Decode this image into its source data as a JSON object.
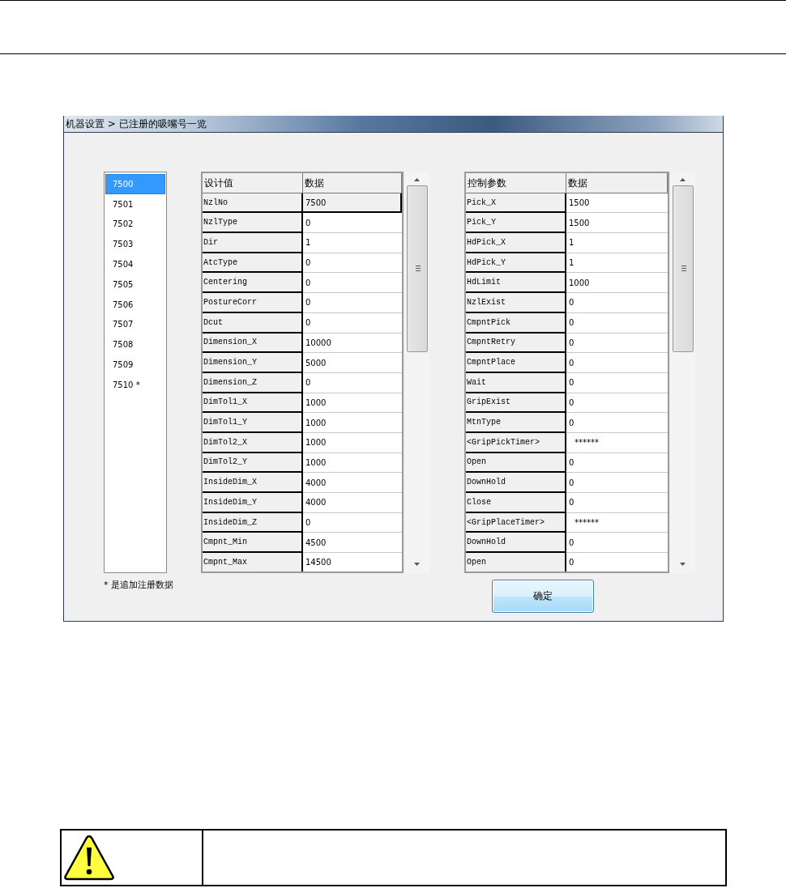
{
  "window": {
    "breadcrumb": "机器设置 > 已注册的吸嘴号一览"
  },
  "nozzle_list": [
    {
      "label": "7500",
      "selected": true
    },
    {
      "label": "7501",
      "selected": false
    },
    {
      "label": "7502",
      "selected": false
    },
    {
      "label": "7503",
      "selected": false
    },
    {
      "label": "7504",
      "selected": false
    },
    {
      "label": "7505",
      "selected": false
    },
    {
      "label": "7506",
      "selected": false
    },
    {
      "label": "7507",
      "selected": false
    },
    {
      "label": "7508",
      "selected": false
    },
    {
      "label": "7509",
      "selected": false
    },
    {
      "label": "7510 *",
      "selected": false
    }
  ],
  "note": "* 是追加注册数据",
  "design_table": {
    "columns": [
      "设计值",
      "数据"
    ],
    "rows": [
      {
        "name": "NzlNo",
        "value": "7500",
        "selected": true
      },
      {
        "name": "NzlType",
        "value": "0",
        "selected": false
      },
      {
        "name": "Dir",
        "value": "1",
        "selected": false
      },
      {
        "name": "AtcType",
        "value": "0",
        "selected": false
      },
      {
        "name": "Centering",
        "value": "0",
        "selected": false
      },
      {
        "name": "PostureCorr",
        "value": "0",
        "selected": false
      },
      {
        "name": "Dcut",
        "value": "0",
        "selected": false
      },
      {
        "name": "Dimension_X",
        "value": "10000",
        "selected": false
      },
      {
        "name": "Dimension_Y",
        "value": "5000",
        "selected": false
      },
      {
        "name": "Dimension_Z",
        "value": "0",
        "selected": false
      },
      {
        "name": "DimTol1_X",
        "value": "1000",
        "selected": false
      },
      {
        "name": "DimTol1_Y",
        "value": "1000",
        "selected": false
      },
      {
        "name": "DimTol2_X",
        "value": "1000",
        "selected": false
      },
      {
        "name": "DimTol2_Y",
        "value": "1000",
        "selected": false
      },
      {
        "name": "InsideDim_X",
        "value": "4000",
        "selected": false
      },
      {
        "name": "InsideDim_Y",
        "value": "4000",
        "selected": false
      },
      {
        "name": "InsideDim_Z",
        "value": "0",
        "selected": false
      },
      {
        "name": "Cmpnt_Min",
        "value": "4500",
        "selected": false
      },
      {
        "name": "Cmpnt_Max",
        "value": "14500",
        "selected": false
      }
    ]
  },
  "control_table": {
    "columns": [
      "控制参数",
      "数据"
    ],
    "rows": [
      {
        "name": "Pick_X",
        "value": "1500"
      },
      {
        "name": "Pick_Y",
        "value": "1500"
      },
      {
        "name": "HdPick_X",
        "value": "1"
      },
      {
        "name": "HdPick_Y",
        "value": "1"
      },
      {
        "name": "HdLimit",
        "value": "1000"
      },
      {
        "name": "NzlExist",
        "value": "0"
      },
      {
        "name": "CmpntPick",
        "value": "0"
      },
      {
        "name": "CmpntRetry",
        "value": "0"
      },
      {
        "name": "CmpntPlace",
        "value": "0"
      },
      {
        "name": "Wait",
        "value": "0"
      },
      {
        "name": "GripExist",
        "value": "0"
      },
      {
        "name": "MtnType",
        "value": "0"
      },
      {
        "name": "<GripPickTimer>",
        "value": "******"
      },
      {
        "name": "Open",
        "value": "0"
      },
      {
        "name": "DownHold",
        "value": "0"
      },
      {
        "name": "Close",
        "value": "0"
      },
      {
        "name": "<GripPlaceTimer>",
        "value": "******"
      },
      {
        "name": "DownHold",
        "value": "0"
      },
      {
        "name": "Open",
        "value": "0"
      }
    ]
  },
  "ok_button": "确定"
}
